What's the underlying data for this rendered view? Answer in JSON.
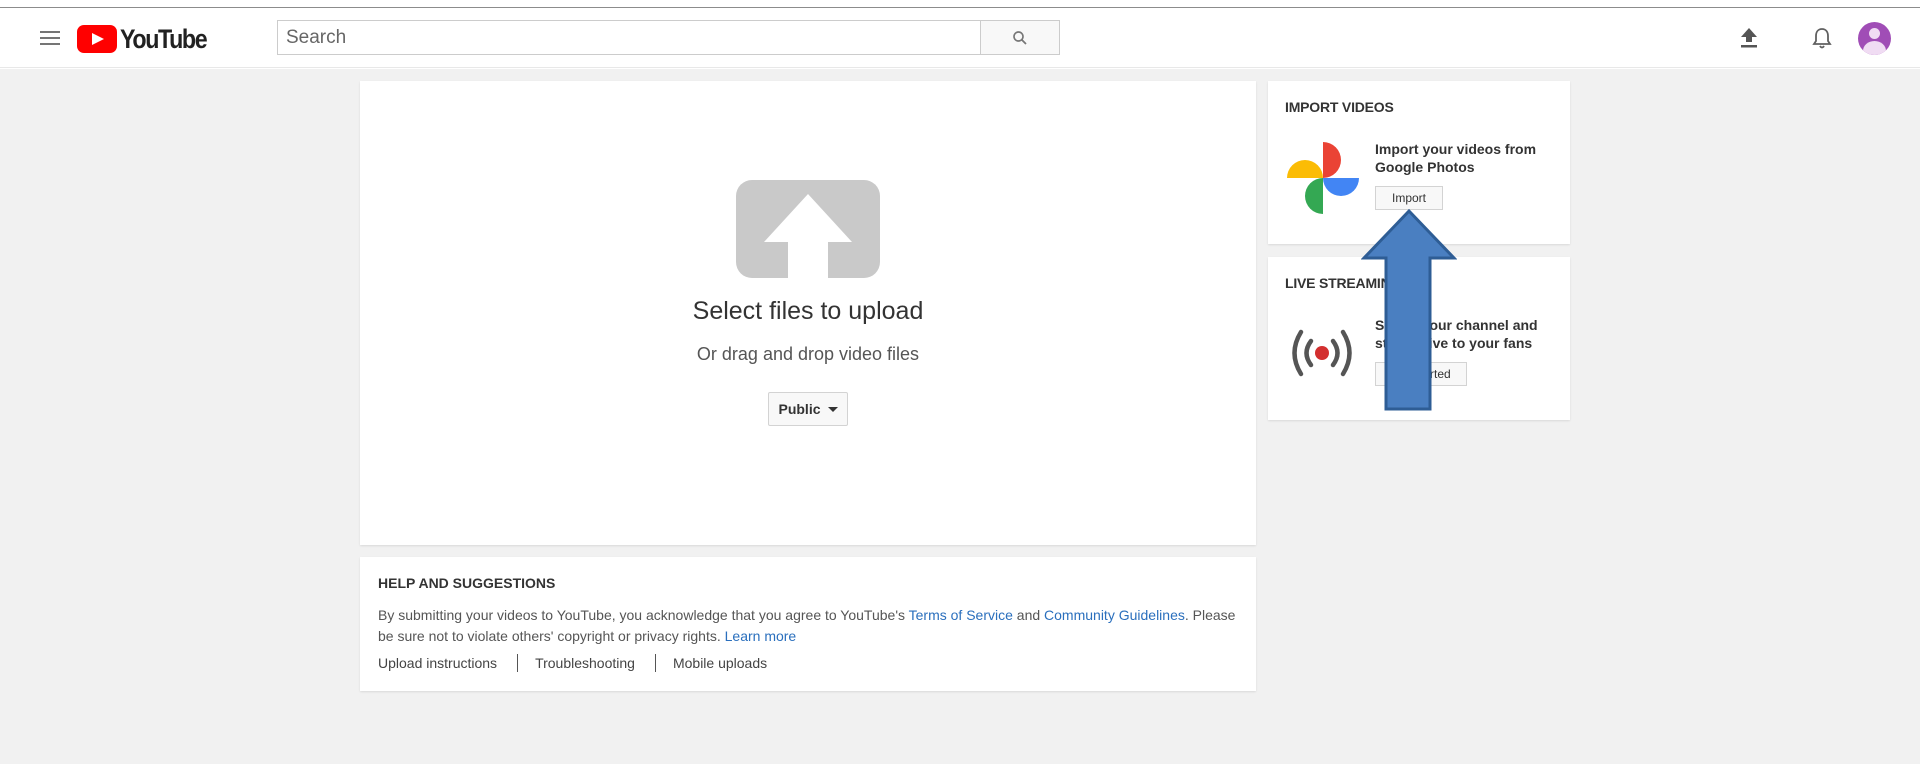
{
  "header": {
    "brand": "YouTube",
    "search_placeholder": "Search"
  },
  "upload": {
    "title": "Select files to upload",
    "subtitle": "Or drag and drop video files",
    "privacy_value": "Public"
  },
  "import_videos": {
    "heading": "IMPORT VIDEOS",
    "description": "Import your videos from Google Photos",
    "button": "Import"
  },
  "live_streaming": {
    "heading": "LIVE STREAMING",
    "description": "Set up your channel and stream live to your fans",
    "button": "Get started"
  },
  "help": {
    "heading": "HELP AND SUGGESTIONS",
    "text_1": "By submitting your videos to YouTube, you acknowledge that you agree to YouTube's ",
    "terms_link": "Terms of Service",
    "text_and": " and ",
    "guidelines_link": "Community Guidelines",
    "text_2": ". Please be sure not to violate others' copyright or privacy rights. ",
    "learn_more": "Learn more",
    "links": [
      "Upload instructions",
      "Troubleshooting",
      "Mobile uploads"
    ]
  },
  "colors": {
    "youtube_red": "#ff0000",
    "link_blue": "#2a6fbd",
    "annotation_arrow": "#4a7fc1",
    "live_red": "#d32f2f"
  },
  "icons": {
    "menu": "hamburger-icon",
    "search": "search-icon",
    "upload": "upload-icon",
    "notifications": "bell-icon",
    "photos": "google-photos-icon",
    "live": "broadcast-icon"
  }
}
